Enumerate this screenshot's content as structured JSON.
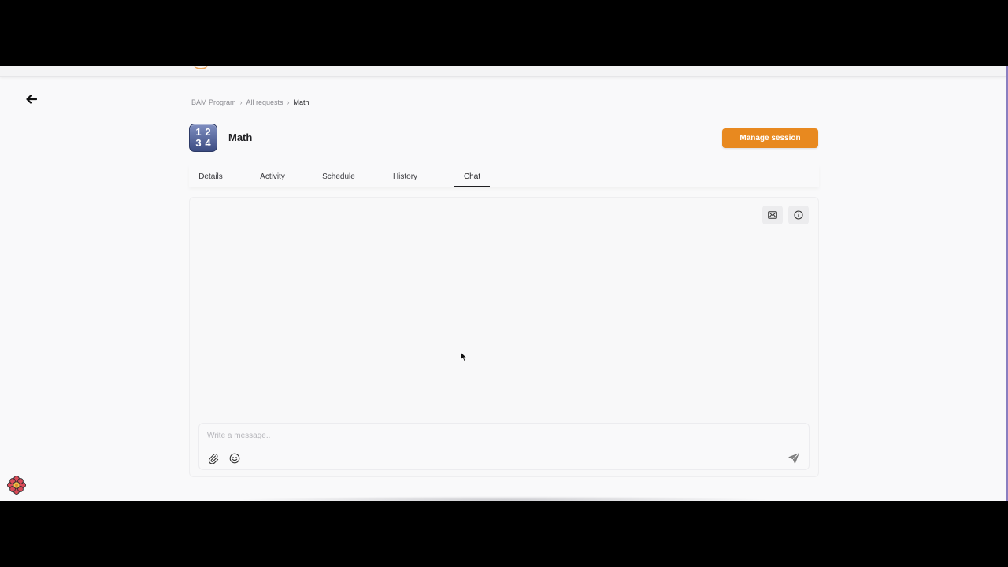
{
  "breadcrumb": {
    "items": [
      "BAM Program",
      "All requests"
    ],
    "current": "Math"
  },
  "page": {
    "title": "Math",
    "subject_icon_digits": [
      "1",
      "2",
      "3",
      "4"
    ]
  },
  "header": {
    "manage_button_label": "Manage session"
  },
  "tabs": [
    {
      "label": "Details",
      "active": false
    },
    {
      "label": "Activity",
      "active": false
    },
    {
      "label": "Schedule",
      "active": false
    },
    {
      "label": "History",
      "active": false
    },
    {
      "label": "Chat",
      "active": true
    }
  ],
  "chat": {
    "toolbar_icons": [
      "mail-icon",
      "info-icon"
    ],
    "composer": {
      "placeholder": "Write a message..",
      "value": "",
      "left_icons": [
        "paperclip-icon",
        "emoji-icon"
      ],
      "send_icon": "send-icon"
    }
  },
  "colors": {
    "accent": "#e8891f",
    "background": "#f9f9fa",
    "text": "#1f1f22"
  }
}
